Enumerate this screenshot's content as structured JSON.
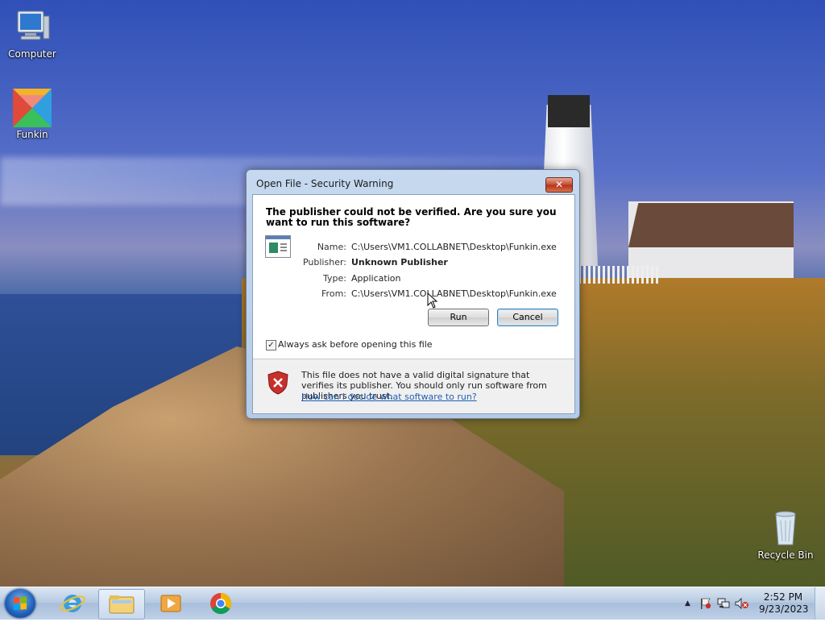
{
  "desktop": {
    "icons": [
      {
        "label": "Computer",
        "icon": "computer-icon"
      },
      {
        "label": "Funkin",
        "icon": "funkin-app-icon"
      },
      {
        "label": "Recycle Bin",
        "icon": "recycle-bin-icon"
      }
    ]
  },
  "dialog": {
    "title": "Open File - Security Warning",
    "close_label": "✕",
    "headline": "The publisher could not be verified.  Are you sure you want to run this software?",
    "fields": [
      {
        "label": "Name:",
        "value": "C:\\Users\\VM1.COLLABNET\\Desktop\\Funkin.exe"
      },
      {
        "label": "Publisher:",
        "value": "Unknown Publisher"
      },
      {
        "label": "Type:",
        "value": "Application"
      },
      {
        "label": "From:",
        "value": "C:\\Users\\VM1.COLLABNET\\Desktop\\Funkin.exe"
      }
    ],
    "run_label": "Run",
    "cancel_label": "Cancel",
    "checkbox_label": "Always ask before opening this file",
    "checkbox_checked": true,
    "warning_text": "This file does not have a valid digital signature that verifies its publisher.  You should only run software from publishers you trust.",
    "help_link": "How can I decide what software to run?"
  },
  "taskbar": {
    "pinned": [
      {
        "icon": "internet-explorer-icon"
      },
      {
        "icon": "file-explorer-icon",
        "active": true
      },
      {
        "icon": "media-player-icon"
      },
      {
        "icon": "chrome-icon"
      }
    ],
    "tray": {
      "time": "2:52 PM",
      "date": "9/23/2023",
      "icons": [
        "show-hidden-icons-chevron",
        "action-center-flag-icon",
        "network-icon",
        "volume-muted-icon"
      ]
    }
  },
  "colors": {
    "dialog_frame": "#b4cbe7",
    "link": "#1d5fb5",
    "close_button": "#c44a2e",
    "taskbar": "#b8cbe2"
  }
}
